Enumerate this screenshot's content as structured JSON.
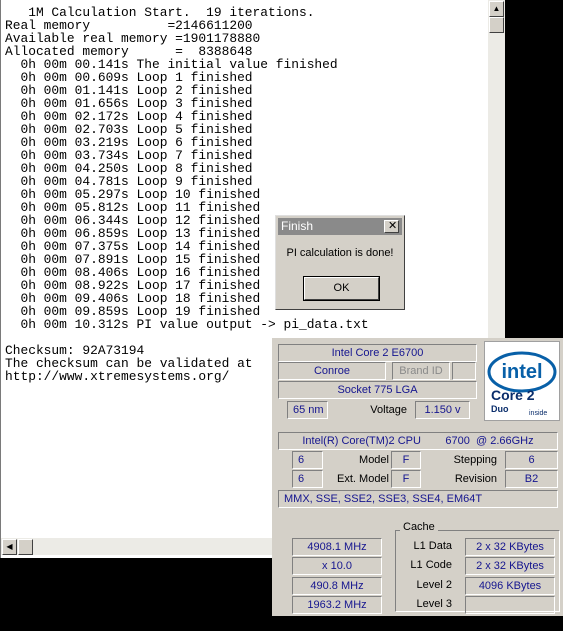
{
  "console": {
    "lines": [
      "   1M Calculation Start.  19 iterations.",
      "Real memory          =2146611200",
      "Available real memory =1901178880",
      "Allocated memory      =  8388648",
      "  0h 00m 00.141s The initial value finished",
      "  0h 00m 00.609s Loop 1 finished",
      "  0h 00m 01.141s Loop 2 finished",
      "  0h 00m 01.656s Loop 3 finished",
      "  0h 00m 02.172s Loop 4 finished",
      "  0h 00m 02.703s Loop 5 finished",
      "  0h 00m 03.219s Loop 6 finished",
      "  0h 00m 03.734s Loop 7 finished",
      "  0h 00m 04.250s Loop 8 finished",
      "  0h 00m 04.781s Loop 9 finished",
      "  0h 00m 05.297s Loop 10 finished",
      "  0h 00m 05.812s Loop 11 finished",
      "  0h 00m 06.344s Loop 12 finished",
      "  0h 00m 06.859s Loop 13 finished",
      "  0h 00m 07.375s Loop 14 finished",
      "  0h 00m 07.891s Loop 15 finished",
      "  0h 00m 08.406s Loop 16 finished",
      "  0h 00m 08.922s Loop 17 finished",
      "  0h 00m 09.406s Loop 18 finished",
      "  0h 00m 09.859s Loop 19 finished",
      "  0h 00m 10.312s PI value output -> pi_data.txt",
      "",
      "Checksum: 92A73194",
      "The checksum can be validated at",
      "http://www.xtremesystems.org/"
    ]
  },
  "dialog": {
    "title": "Finish",
    "close_glyph": "✕",
    "message": "PI calculation is done!",
    "ok_label": "OK"
  },
  "scrollbar": {
    "up_glyph": "▲",
    "left_glyph": "◀"
  },
  "cpuz": {
    "name": "Intel Core 2 E6700",
    "code_name": "Conroe",
    "brand_id_label": "Brand ID",
    "package": "Socket 775 LGA",
    "technology": "65 nm",
    "voltage_label": "Voltage",
    "voltage": "1.150 v",
    "specification": "Intel(R) Core(TM)2 CPU        6700  @ 2.66GHz",
    "family": "6",
    "model_label": "Model",
    "model": "F",
    "stepping_label": "Stepping",
    "stepping": "6",
    "ext_family": "6",
    "ext_model_label": "Ext. Model",
    "ext_model": "F",
    "revision_label": "Revision",
    "revision": "B2",
    "instructions": "MMX, SSE, SSE2, SSE3, SSE4, EM64T",
    "clocks": {
      "core_speed": "4908.1 MHz",
      "multiplier": "x 10.0",
      "bus_speed": "490.8 MHz",
      "rated_fsb": "1963.2 MHz"
    },
    "cache": {
      "title": "Cache",
      "l1_data_label": "L1 Data",
      "l1_data": "2 x 32 KBytes",
      "l1_code_label": "L1 Code",
      "l1_code": "2 x 32 KBytes",
      "level2_label": "Level 2",
      "level2": "4096 KBytes",
      "level3_label": "Level 3"
    },
    "logo": {
      "brand": "intel",
      "product": "Core 2",
      "sub": "Duo",
      "tag": "inside",
      "colors": {
        "blue": "#0860a8",
        "dark": "#0a2d6b"
      }
    }
  }
}
